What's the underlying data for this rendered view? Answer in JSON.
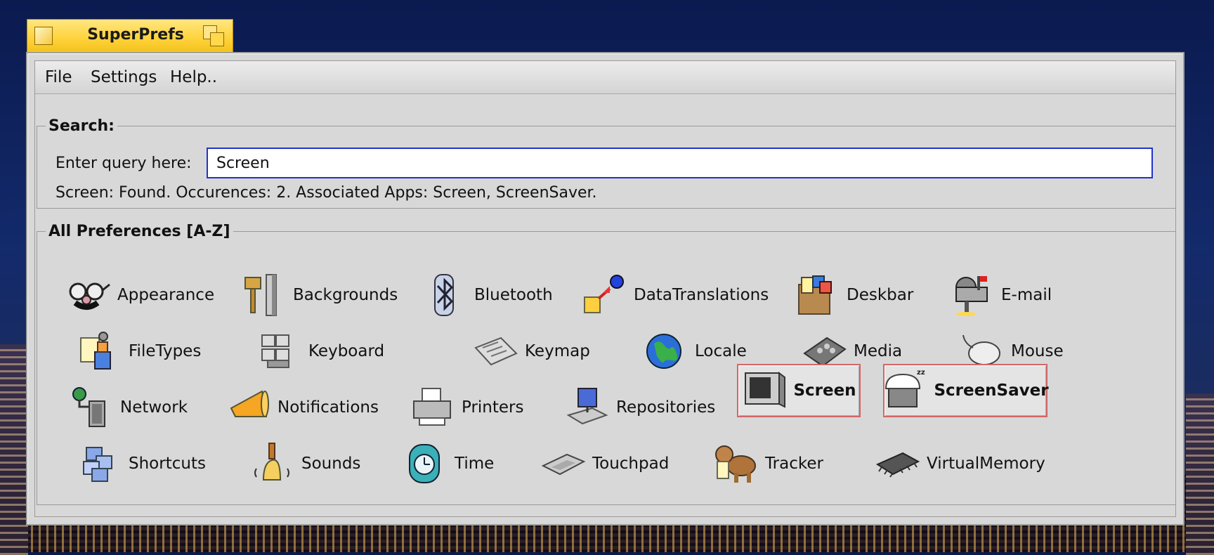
{
  "window": {
    "title": "SuperPrefs"
  },
  "menubar": {
    "items": [
      "File",
      "Settings",
      "Help.."
    ]
  },
  "search": {
    "legend": "Search:",
    "label": "Enter query here:",
    "value": "Screen",
    "status": "Screen: Found. Occurences: 2. Associated Apps: Screen, ScreenSaver."
  },
  "prefs": {
    "legend": "All Preferences [A-Z]",
    "items": [
      {
        "label": "Appearance",
        "icon": "appearance-icon",
        "selected": false
      },
      {
        "label": "Backgrounds",
        "icon": "backgrounds-icon",
        "selected": false
      },
      {
        "label": "Bluetooth",
        "icon": "bluetooth-icon",
        "selected": false
      },
      {
        "label": "DataTranslations",
        "icon": "datatranslations-icon",
        "selected": false
      },
      {
        "label": "Deskbar",
        "icon": "deskbar-icon",
        "selected": false
      },
      {
        "label": "E-mail",
        "icon": "mailbox-icon",
        "selected": false
      },
      {
        "label": "FileTypes",
        "icon": "filetypes-icon",
        "selected": false
      },
      {
        "label": "Keyboard",
        "icon": "keyboard-icon",
        "selected": false
      },
      {
        "label": "Keymap",
        "icon": "keymap-icon",
        "selected": false
      },
      {
        "label": "Locale",
        "icon": "globe-icon",
        "selected": false
      },
      {
        "label": "Media",
        "icon": "media-mixer-icon",
        "selected": false
      },
      {
        "label": "Mouse",
        "icon": "mouse-icon",
        "selected": false
      },
      {
        "label": "Network",
        "icon": "network-icon",
        "selected": false
      },
      {
        "label": "Notifications",
        "icon": "megaphone-icon",
        "selected": false
      },
      {
        "label": "Printers",
        "icon": "printer-icon",
        "selected": false
      },
      {
        "label": "Repositories",
        "icon": "repositories-icon",
        "selected": false
      },
      {
        "label": "Screen",
        "icon": "monitor-icon",
        "selected": true
      },
      {
        "label": "ScreenSaver",
        "icon": "screensaver-icon",
        "selected": true
      },
      {
        "label": "Shortcuts",
        "icon": "shortcuts-icon",
        "selected": false
      },
      {
        "label": "Sounds",
        "icon": "bell-icon",
        "selected": false
      },
      {
        "label": "Time",
        "icon": "clock-icon",
        "selected": false
      },
      {
        "label": "Touchpad",
        "icon": "touchpad-icon",
        "selected": false
      },
      {
        "label": "Tracker",
        "icon": "tracker-dog-icon",
        "selected": false
      },
      {
        "label": "VirtualMemory",
        "icon": "memory-chip-icon",
        "selected": false
      }
    ]
  },
  "colors": {
    "tab": "#ffd23a",
    "input_border": "#2233cc",
    "selection_border": "#d26666"
  }
}
